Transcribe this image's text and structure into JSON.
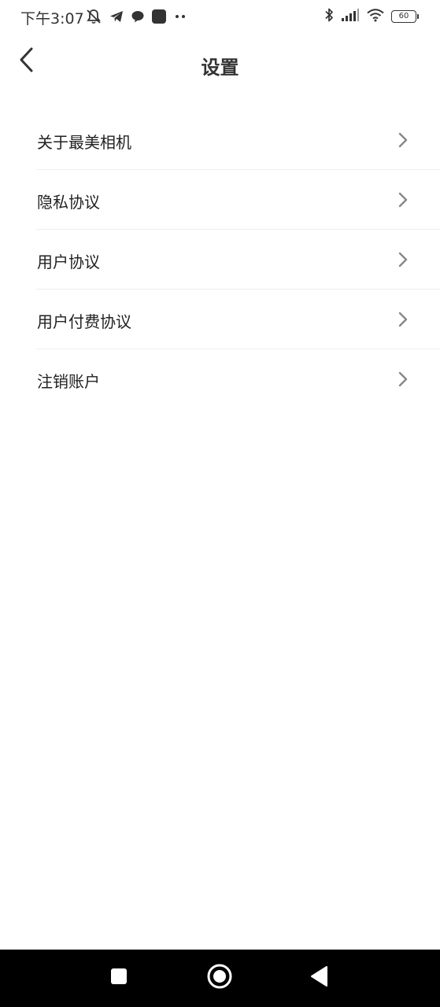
{
  "status_bar": {
    "time": "下午3:07",
    "battery_level": "60",
    "left_icons": [
      "muted-bell-icon",
      "telegram-icon",
      "chat-bubble-icon",
      "app-square-icon",
      "more-dots-icon"
    ],
    "right_icons": [
      "bluetooth-icon",
      "signal-icon",
      "wifi-icon",
      "battery-icon"
    ]
  },
  "header": {
    "title": "设置",
    "back_icon": "chevron-left-icon"
  },
  "settings": {
    "items": [
      {
        "label": "关于最美相机",
        "icon": "chevron-right-icon"
      },
      {
        "label": "隐私协议",
        "icon": "chevron-right-icon"
      },
      {
        "label": "用户协议",
        "icon": "chevron-right-icon"
      },
      {
        "label": "用户付费协议",
        "icon": "chevron-right-icon"
      },
      {
        "label": "注销账户",
        "icon": "chevron-right-icon"
      }
    ]
  },
  "nav_bar": {
    "buttons": [
      "recent-apps-icon",
      "home-icon",
      "back-triangle-icon"
    ]
  },
  "colors": {
    "background": "#ffffff",
    "text": "#222222",
    "divider": "#eeeeee",
    "chevron": "#888888",
    "nav_bar": "#000000"
  }
}
